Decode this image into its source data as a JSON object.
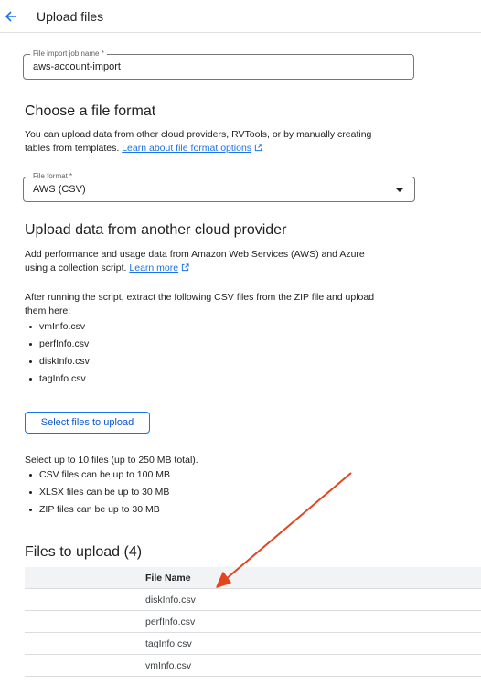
{
  "header": {
    "title": "Upload files"
  },
  "job_name": {
    "label": "File import job name *",
    "value": "aws-account-import"
  },
  "format_section": {
    "heading": "Choose a file format",
    "description_line1": "You can upload data from other cloud providers, RVTools, or by manually creating",
    "description_line2": "tables from templates.",
    "link": "Learn about file format options"
  },
  "file_format": {
    "label": "File format *",
    "value": "AWS (CSV)"
  },
  "cloud_section": {
    "heading": "Upload data from another cloud provider",
    "description_line1": "Add performance and usage data from Amazon Web Services (AWS) and Azure",
    "description_line2": "using a collection script.",
    "link": "Learn more",
    "after_line1": "After running the script, extract the following CSV files from the ZIP file and upload",
    "after_line2": "them here:",
    "files": [
      "vmInfo.csv",
      "perfInfo.csv",
      "diskInfo.csv",
      "tagInfo.csv"
    ]
  },
  "select_button": "Select files to upload",
  "limits": {
    "intro": "Select up to 10 files (up to 250 MB total).",
    "items": [
      "CSV files can be up to 100 MB",
      "XLSX files can be up to 30 MB",
      "ZIP files can be up to 30 MB"
    ]
  },
  "files_to_upload": {
    "heading": "Files to upload (4)",
    "column_header": "File Name",
    "rows": [
      "diskInfo.csv",
      "perfInfo.csv",
      "tagInfo.csv",
      "vmInfo.csv"
    ]
  },
  "colors": {
    "accent": "#1a73e8",
    "annotation_arrow": "#e8431f"
  },
  "icons": {
    "back": "arrow-left-icon",
    "external": "external-link-icon",
    "dropdown": "caret-down-icon"
  }
}
